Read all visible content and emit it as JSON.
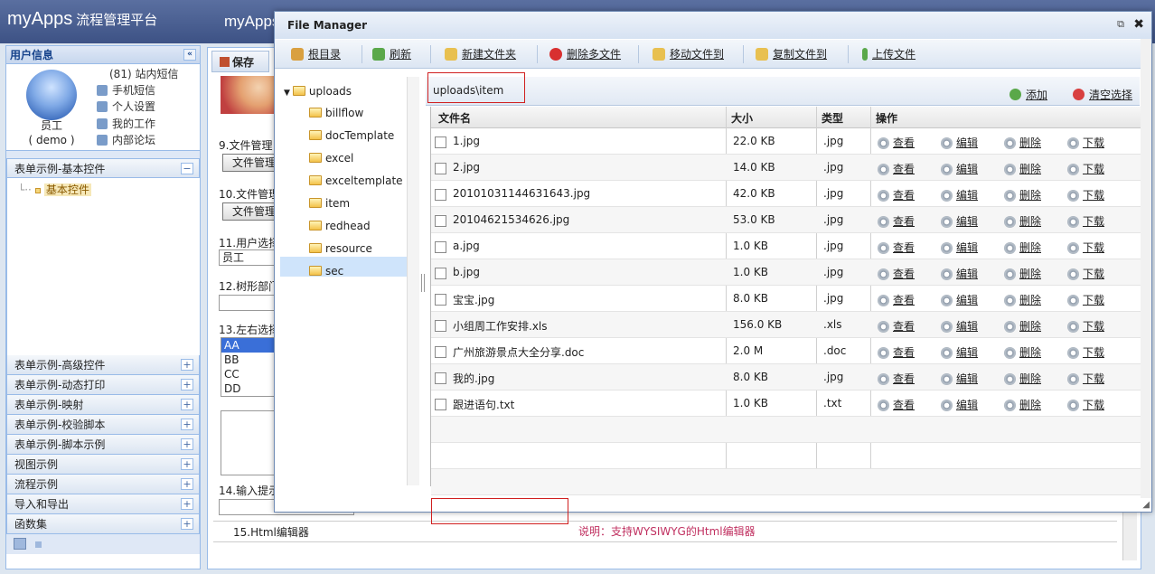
{
  "header": {
    "logo_main": "myApps",
    "logo_sub": "流程管理平台",
    "logo_second": "myApps"
  },
  "left": {
    "user_panel_title": "用户信息",
    "user_name": "员工",
    "user_id": "( demo )",
    "links": [
      "(81) 站内短信",
      "手机短信",
      "个人设置",
      "我的工作",
      "内部论坛"
    ],
    "group_open_title": "表单示例-基本控件",
    "group_open_item": "基本控件",
    "groups": [
      "表单示例-高级控件",
      "表单示例-动态打印",
      "表单示例-映射",
      "表单示例-校验脚本",
      "表单示例-脚本示例",
      "视图示例",
      "流程示例",
      "导入和导出",
      "函数集"
    ]
  },
  "form": {
    "save": "保存",
    "l9": "9.文件管理",
    "b9": "文件管理",
    "l10": "10.文件管理",
    "b10": "文件管理",
    "l11": "11.用户选择",
    "v11": "员工",
    "l12": "12.树形部门",
    "l13": "13.左右选择",
    "list": [
      "AA",
      "BB",
      "CC",
      "DD"
    ],
    "l14": "14.输入提示",
    "l15": "15.Html编辑器",
    "note15": "说明：支持WYSIWYG的Html编辑器"
  },
  "fm": {
    "title": "File Manager",
    "toolbar": [
      "根目录",
      "刷新",
      "新建文件夹",
      "删除多文件",
      "移动文件到",
      "复制文件到",
      "上传文件"
    ],
    "tree_root": "uploads",
    "tree": [
      "billflow",
      "docTemplate",
      "excel",
      "exceltemplate",
      "item",
      "redhead",
      "resource",
      "sec"
    ],
    "path": "uploads\\item",
    "add": "添加",
    "clear": "清空选择",
    "cols": [
      "文件名",
      "大小",
      "类型",
      "操作"
    ],
    "actions": [
      "查看",
      "编辑",
      "删除",
      "下载"
    ],
    "files": [
      {
        "name": "1.jpg",
        "size": "22.0 KB",
        "type": ".jpg"
      },
      {
        "name": "2.jpg",
        "size": "14.0 KB",
        "type": ".jpg"
      },
      {
        "name": "20101031144631643.jpg",
        "size": "42.0 KB",
        "type": ".jpg"
      },
      {
        "name": "20104621534626.jpg",
        "size": "53.0 KB",
        "type": ".jpg"
      },
      {
        "name": "a.jpg",
        "size": "1.0 KB",
        "type": ".jpg"
      },
      {
        "name": "b.jpg",
        "size": "1.0 KB",
        "type": ".jpg"
      },
      {
        "name": "宝宝.jpg",
        "size": "8.0 KB",
        "type": ".jpg"
      },
      {
        "name": "小组周工作安排.xls",
        "size": "156.0 KB",
        "type": ".xls"
      },
      {
        "name": "广州旅游景点大全分享.doc",
        "size": "2.0 M",
        "type": ".doc"
      },
      {
        "name": "我的.jpg",
        "size": "8.0 KB",
        "type": ".jpg"
      },
      {
        "name": "跟进语句.txt",
        "size": "1.0 KB",
        "type": ".txt"
      }
    ]
  }
}
